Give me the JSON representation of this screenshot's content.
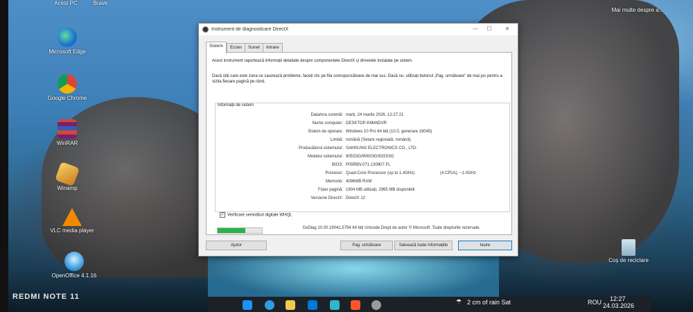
{
  "phone_watermark": "REDMI NOTE 11",
  "desktop": {
    "icons": [
      {
        "label": "Acest PC",
        "icon": "computer-icon"
      },
      {
        "label": "Brave",
        "icon": "brave-icon"
      },
      {
        "label": "Microsoft Edge",
        "icon": "edge-icon"
      },
      {
        "label": "Google Chrome",
        "icon": "chrome-icon"
      },
      {
        "label": "WinRAR",
        "icon": "winrar-icon"
      },
      {
        "label": "Winamp",
        "icon": "winamp-icon"
      },
      {
        "label": "VLC media player",
        "icon": "vlc-icon"
      },
      {
        "label": "OpenOffice 4.1.16",
        "icon": "openoffice-icon"
      },
      {
        "label": "Coș de reciclare",
        "icon": "recycle-bin-icon"
      }
    ],
    "top_right_text": "Mai multe despre a..."
  },
  "dialog": {
    "title": "Instrument de diagnosticare DirectX",
    "tabs": [
      "Sistem",
      "Ecran",
      "Sunet",
      "Intrare"
    ],
    "active_tab": "Sistem",
    "intro": "Acest instrument raportează informații detaliate despre componentele DirectX și driverele instalate pe sistem.",
    "help": "Dacă știți care este zona ce cauzează probleme, faceți clic pe fila corespunzătoare de mai sus. Dacă nu, utilizați butonul „Pag. următoare” de mai jos pentru a vizita fiecare pagină pe rând.",
    "group_title": "Informații de sistem",
    "system_info": [
      {
        "label": "Data/ora curentă:",
        "value": "marți, 24 martie 2026, 12:27:21"
      },
      {
        "label": "Nume computer:",
        "value": "DESKTOP-K6M4DVR"
      },
      {
        "label": "Sistem de operare:",
        "value": "Windows 10 Pro 64 biți (10.0, generare 19045)"
      },
      {
        "label": "Limbă:",
        "value": "română (Setare regională: română)"
      },
      {
        "label": "Producătorul sistemului:",
        "value": "SAMSUNG ELECTRONICS CO., LTD."
      },
      {
        "label": "Modelul sistemului:",
        "value": "905S3G/906S3G/915S3G"
      },
      {
        "label": "BIOS:",
        "value": "P05RBV.071.130807.FL"
      },
      {
        "label": "Procesor:",
        "value": "Quad-Core Processor (up to 1.4GHz)",
        "extra": "(4 CPUs), ~1.0GHz"
      },
      {
        "label": "Memorie:",
        "value": "4096MB RAM"
      },
      {
        "label": "Fișier paginã:",
        "value": "1904 MB utilizați, 2965 MB disponibili"
      },
      {
        "label": "Versiune DirectX:",
        "value": "DirectX 12"
      }
    ],
    "whql_label": "Verificare semnături digitale WHQL",
    "whql_checked": true,
    "progress_fraction": 0.62,
    "footer": "DxDiag 10.00.19041.5794 64 biți Unicode  Drept de autor © Microsoft. Toate drepturile rezervate.",
    "buttons": {
      "help": "Ajutor",
      "next": "Pag. următoare",
      "save": "Salvează toate informațiile",
      "exit": "Ieșire"
    },
    "window_controls": {
      "minimize": "—",
      "maximize": "☐",
      "close": "✕"
    }
  },
  "taskbar": {
    "weather": "2 cm of rain Sat",
    "language": "ROU",
    "time": "12:27",
    "date": "24.03.2026"
  },
  "colors": {
    "progress": "#2bb34a",
    "accent": "#0078d7"
  }
}
